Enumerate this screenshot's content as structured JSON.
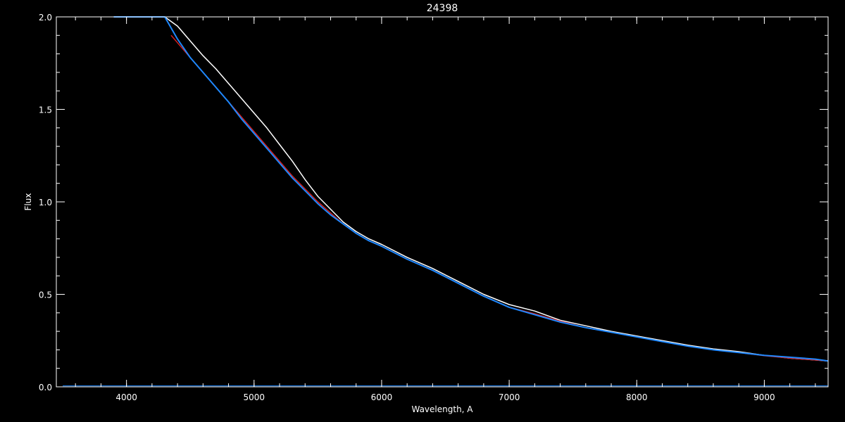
{
  "chart_data": {
    "type": "line",
    "title": "24398",
    "xlabel": "Wavelength, A",
    "ylabel": "Flux",
    "xlim": [
      3450,
      9500
    ],
    "ylim": [
      0,
      2.0
    ],
    "grid": false,
    "background": "#000000",
    "x_ticks": [
      {
        "value": 4000,
        "label": "4000"
      },
      {
        "value": 5000,
        "label": "5000"
      },
      {
        "value": 6000,
        "label": "6000"
      },
      {
        "value": 7000,
        "label": "7000"
      },
      {
        "value": 8000,
        "label": "8000"
      },
      {
        "value": 9000,
        "label": "9000"
      }
    ],
    "y_ticks": [
      {
        "value": 0.0,
        "label": "0.0"
      },
      {
        "value": 0.5,
        "label": "0.5"
      },
      {
        "value": 1.0,
        "label": "1.0"
      },
      {
        "value": 1.5,
        "label": "1.5"
      },
      {
        "value": 2.0,
        "label": "2.0"
      }
    ],
    "x_minor_step": 200,
    "y_minor_step": 0.1,
    "series": [
      {
        "color": "#ffffff",
        "x": [
          4300,
          4400,
          4500,
          4600,
          4700,
          4800,
          4900,
          5000,
          5100,
          5200,
          5300,
          5400,
          5500,
          5600,
          5700,
          5800,
          5900,
          6000,
          6200,
          6400,
          6600,
          6800,
          7000,
          7200,
          7400,
          7600,
          7800,
          8000,
          8200,
          8400,
          8600,
          8800,
          9000,
          9200,
          9400,
          9500
        ],
        "y": [
          2.0,
          1.95,
          1.87,
          1.79,
          1.72,
          1.64,
          1.56,
          1.48,
          1.4,
          1.31,
          1.22,
          1.12,
          1.03,
          0.96,
          0.89,
          0.84,
          0.8,
          0.77,
          0.7,
          0.64,
          0.57,
          0.5,
          0.445,
          0.41,
          0.36,
          0.33,
          0.3,
          0.275,
          0.25,
          0.225,
          0.205,
          0.19,
          0.17,
          0.155,
          0.145,
          0.14
        ]
      },
      {
        "color": "#d02020",
        "x": [
          4350,
          4400,
          4500,
          4600,
          4700,
          4800,
          4900,
          5000,
          5100,
          5200,
          5300,
          5400,
          5500,
          5600,
          5700,
          5800,
          5900,
          6000,
          6200,
          6400,
          6600,
          6800,
          7000,
          7200,
          7400,
          7600,
          7800,
          8000,
          8200,
          8400,
          8600,
          8800,
          9000,
          9200,
          9400,
          9500
        ],
        "y": [
          1.9,
          1.86,
          1.78,
          1.7,
          1.62,
          1.54,
          1.46,
          1.38,
          1.3,
          1.22,
          1.14,
          1.07,
          1.0,
          0.94,
          0.88,
          0.83,
          0.79,
          0.76,
          0.69,
          0.63,
          0.56,
          0.49,
          0.43,
          0.395,
          0.355,
          0.32,
          0.295,
          0.27,
          0.245,
          0.22,
          0.2,
          0.185,
          0.168,
          0.155,
          0.145,
          0.14
        ]
      },
      {
        "color": "#1e88ff",
        "x": [
          3900,
          4000,
          4100,
          4200,
          4300,
          4400,
          4500,
          4600,
          4700,
          4800,
          4900,
          5000,
          5100,
          5200,
          5300,
          5400,
          5500,
          5600,
          5700,
          5800,
          5900,
          6000,
          6200,
          6400,
          6600,
          6800,
          7000,
          7200,
          7400,
          7600,
          7800,
          8000,
          8200,
          8400,
          8600,
          8800,
          9000,
          9200,
          9400,
          9500
        ],
        "y": [
          2.0,
          2.0,
          2.0,
          2.0,
          2.0,
          1.88,
          1.78,
          1.7,
          1.62,
          1.54,
          1.45,
          1.37,
          1.29,
          1.21,
          1.13,
          1.06,
          0.99,
          0.93,
          0.88,
          0.83,
          0.79,
          0.76,
          0.69,
          0.63,
          0.56,
          0.49,
          0.43,
          0.39,
          0.35,
          0.32,
          0.295,
          0.27,
          0.245,
          0.22,
          0.2,
          0.185,
          0.17,
          0.16,
          0.15,
          0.14
        ]
      }
    ]
  }
}
